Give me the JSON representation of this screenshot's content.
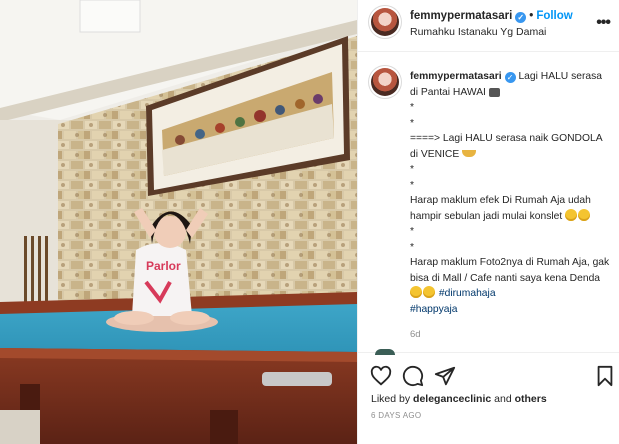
{
  "post": {
    "username": "femmypermatasari",
    "follow_label": "Follow",
    "separator": "•",
    "location": "Rumahku Istanaku Yg Damai",
    "more_icon": "more-horizontal-icon"
  },
  "caption": {
    "username": "femmypermatasari",
    "lines": [
      " Lagi HALU serasa di Pantai HAWAI",
      "*",
      "*",
      "====> Lagi HALU serasa naik GONDOLA di VENICE",
      "*",
      "*",
      "Harap maklum efek Di Rumah Aja udah hampir sebulan jadi mulai konslet",
      "*",
      "*",
      "Harap maklum Foto2nya di Rumah Aja, gak bisa di Mall / Cafe nanti saya kena Denda"
    ],
    "hashtags": [
      "#dirumahaja",
      "#happyaja"
    ],
    "time": "6d"
  },
  "actions": {
    "like_icon": "heart-icon",
    "comment_icon": "comment-icon",
    "share_icon": "share-icon",
    "save_icon": "bookmark-icon",
    "liked_by_prefix": "Liked by ",
    "liked_by_user": "delegance​clinic",
    "liked_by_suffix": " and ",
    "liked_by_others": "others",
    "posted_ago": "6 DAYS AGO"
  },
  "colors": {
    "link": "#0095f6",
    "verified": "#3897f0",
    "hashtag": "#00376b",
    "muted": "#8e8e8e"
  }
}
